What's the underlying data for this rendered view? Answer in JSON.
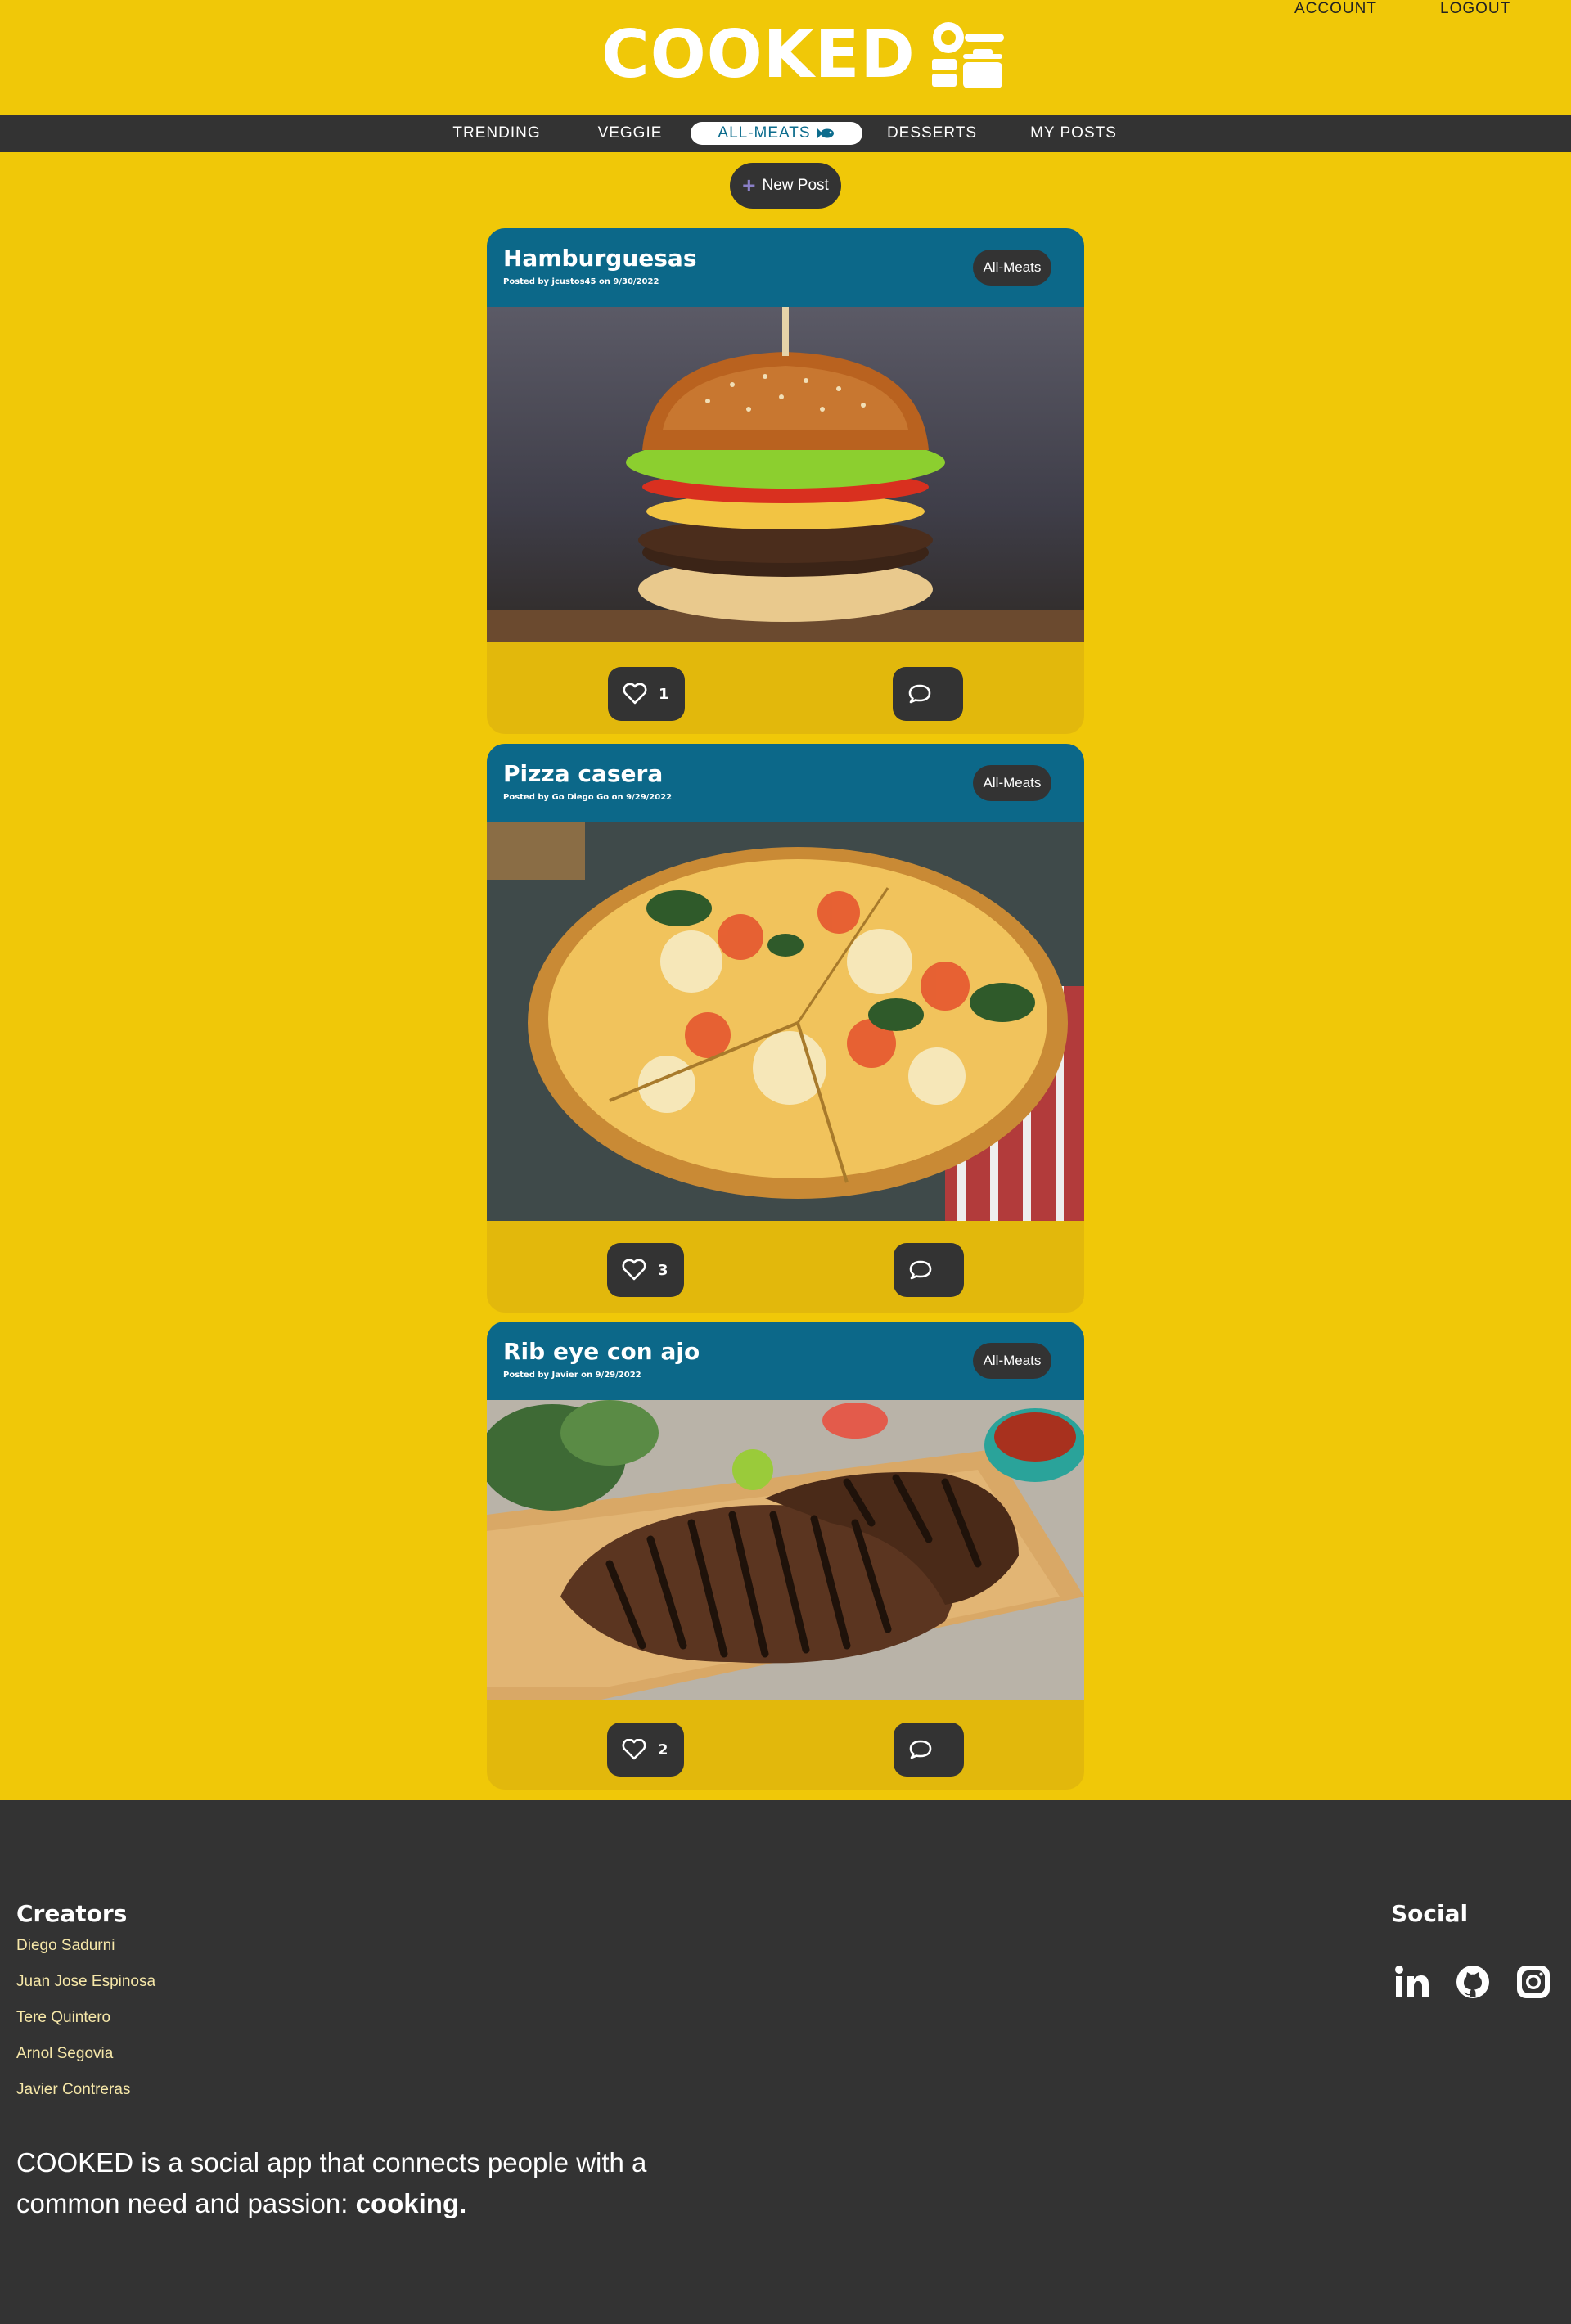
{
  "header": {
    "logo_text": "COOKED",
    "account_label": "ACCOUNT",
    "logout_label": "LOGOUT"
  },
  "nav": {
    "items": [
      {
        "label": "TRENDING"
      },
      {
        "label": "VEGGIE"
      },
      {
        "label": "ALL-MEATS",
        "active": true
      },
      {
        "label": "DESSERTS"
      },
      {
        "label": "MY POSTS"
      }
    ]
  },
  "new_post_label": "New Post",
  "posts": [
    {
      "title": "Hamburguesas",
      "meta": "Posted by jcustos45 on 9/30/2022",
      "category": "All-Meats",
      "likes": "1",
      "image": "hamburger-photo"
    },
    {
      "title": "Pizza casera",
      "meta": "Posted by Go Diego Go on 9/29/2022",
      "category": "All-Meats",
      "likes": "3",
      "image": "pizza-photo"
    },
    {
      "title": "Rib eye con ajo",
      "meta": "Posted by Javier on 9/29/2022",
      "category": "All-Meats",
      "likes": "2",
      "image": "steak-photo"
    }
  ],
  "footer": {
    "creators_heading": "Creators",
    "creators": [
      "Diego Sadurni",
      "Juan Jose Espinosa",
      "Tere Quintero",
      "Arnol Segovia",
      "Javier Contreras"
    ],
    "social_heading": "Social",
    "social_icons": [
      "linkedin-icon",
      "github-icon",
      "instagram-icon"
    ],
    "about_text": "COOKED is a social app that connects people with a common need and passion: ",
    "about_bold": "cooking."
  },
  "colors": {
    "page_bg": "#F0C808",
    "dark": "#333333",
    "card_header": "#0C6889",
    "card_footer": "#E2B80C",
    "active_nav_text": "#0C6C8D"
  }
}
